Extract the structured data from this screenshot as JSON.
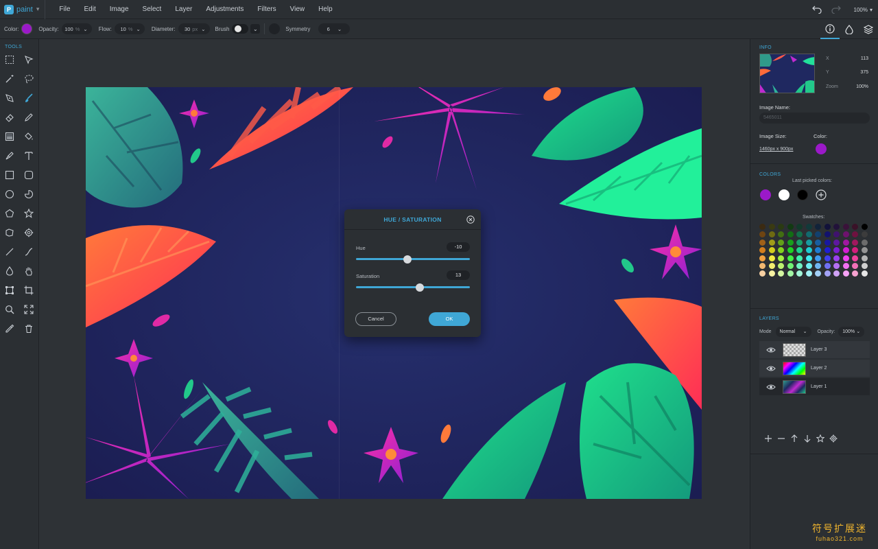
{
  "app": {
    "name": "paint",
    "logo_glyph": "P"
  },
  "menu": [
    "File",
    "Edit",
    "Image",
    "Select",
    "Layer",
    "Adjustments",
    "Filters",
    "View",
    "Help"
  ],
  "header_right": {
    "zoom": "100%",
    "undo_icon": "undo-icon",
    "redo_icon": "redo-icon"
  },
  "options": {
    "color_label": "Color:",
    "color": "#9b19c9",
    "opacity_label": "Opacity:",
    "opacity_value": "100",
    "opacity_unit": "%",
    "flow_label": "Flow:",
    "flow_value": "10",
    "flow_unit": "%",
    "diameter_label": "Diameter:",
    "diameter_value": "30",
    "diameter_unit": "px",
    "brush_label": "Brush",
    "symmetry_label": "Symmetry",
    "symmetry_value": "6"
  },
  "tools_title": "TOOLS",
  "tools": [
    "rect-select",
    "move",
    "magic-wand",
    "lasso",
    "pen",
    "brush",
    "eraser",
    "pencil",
    "gradient",
    "paint-bucket",
    "clone-stamp",
    "text",
    "rectangle",
    "rounded-rectangle",
    "ellipse",
    "pie",
    "polygon",
    "star",
    "shape",
    "gear-shape",
    "line",
    "curve",
    "drop",
    "hand",
    "transform",
    "crop",
    "zoom",
    "fit-screen",
    "eyedropper",
    "trash"
  ],
  "dialog": {
    "title": "HUE / SATURATION",
    "hue_label": "Hue",
    "hue_value": "-10",
    "hue_pos": 0.45,
    "saturation_label": "Saturation",
    "saturation_value": "13",
    "saturation_pos": 0.56,
    "cancel": "Cancel",
    "ok": "OK"
  },
  "info": {
    "title": "INFO",
    "x_label": "X",
    "x_value": "113",
    "y_label": "Y",
    "y_value": "375",
    "zoom_label": "Zoom",
    "zoom_value": "100%",
    "image_name_label": "Image Name:",
    "image_name_placeholder": "5465011",
    "image_size_label": "Image Size:",
    "image_size_value": "1460px x 900px",
    "color_label": "Color:",
    "color": "#9b19c9"
  },
  "colors": {
    "title": "COLORS",
    "last_picked_label": "Last picked colors:",
    "last_picked": [
      "#9b19c9",
      "#ffffff",
      "#000000"
    ],
    "swatches_label": "Swatches:",
    "swatch_rows": [
      [
        "#3b2a12",
        "#3a3a12",
        "#2a3a12",
        "#123a12",
        "#123a2a",
        "#123a3a",
        "#12233a",
        "#12123a",
        "#22123a",
        "#3a123a",
        "#3a1228",
        "#000000"
      ],
      [
        "#6e4412",
        "#6e6a12",
        "#426e12",
        "#126e14",
        "#126e48",
        "#126a6e",
        "#12406e",
        "#12126e",
        "#40126e",
        "#6e126e",
        "#6e1240",
        "#3c3c3c"
      ],
      [
        "#a06018",
        "#a09c18",
        "#62a018",
        "#18a01c",
        "#18a06a",
        "#189ca0",
        "#185ea0",
        "#1818a0",
        "#5e18a0",
        "#a018a0",
        "#a0185e",
        "#6c6c6c"
      ],
      [
        "#d27e1e",
        "#d2cc1e",
        "#82d21e",
        "#1ed224",
        "#1ed28c",
        "#1eccd2",
        "#1e7cd2",
        "#1e1ed2",
        "#7c1ed2",
        "#d21ed2",
        "#d21e7c",
        "#949494"
      ],
      [
        "#f0a040",
        "#f0ea40",
        "#a2f040",
        "#40f046",
        "#40f0ac",
        "#40eaf0",
        "#409cf0",
        "#4040f0",
        "#9c40f0",
        "#f040f0",
        "#f0409c",
        "#b4b4b4"
      ],
      [
        "#f2b870",
        "#f2ee70",
        "#bcf270",
        "#70f274",
        "#70f2c2",
        "#70eef2",
        "#70b6f2",
        "#7070f2",
        "#b670f2",
        "#f270f2",
        "#f270b6",
        "#cfcfcf"
      ],
      [
        "#f6d0a2",
        "#f6f2a2",
        "#d4f6a2",
        "#a2f6a4",
        "#a2f6d8",
        "#a2f2f6",
        "#a2d0f6",
        "#a2a2f6",
        "#d0a2f6",
        "#f6a2f6",
        "#f6a2d0",
        "#e6e6e6"
      ]
    ]
  },
  "layers": {
    "title": "LAYERS",
    "mode_label": "Mode",
    "mode_value": "Normal",
    "opacity_label": "Opacity:",
    "opacity_value": "100%",
    "items": [
      {
        "name": "Layer 3",
        "thumb": "transparent"
      },
      {
        "name": "Layer 2",
        "thumb": "rainbow"
      },
      {
        "name": "Layer 1",
        "thumb": "image"
      }
    ]
  },
  "watermark": {
    "line1": "符号扩展迷",
    "line2": "fuhao321.com"
  }
}
